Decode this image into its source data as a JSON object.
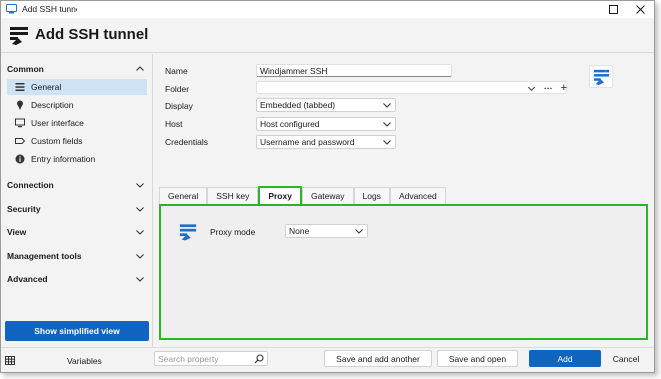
{
  "window": {
    "title": "Add SSH tunnel",
    "header_title": "Add SSH tunnel"
  },
  "sidebar": {
    "sections": [
      {
        "label": "Common",
        "expanded": true
      },
      {
        "label": "Connection",
        "expanded": false
      },
      {
        "label": "Security",
        "expanded": false
      },
      {
        "label": "View",
        "expanded": false
      },
      {
        "label": "Management tools",
        "expanded": false
      },
      {
        "label": "Advanced",
        "expanded": false
      }
    ],
    "common_items": [
      {
        "label": "General",
        "icon": "list-icon",
        "active": true
      },
      {
        "label": "Description",
        "icon": "pin-icon"
      },
      {
        "label": "User interface",
        "icon": "monitor-icon"
      },
      {
        "label": "Custom fields",
        "icon": "tag-icon"
      },
      {
        "label": "Entry information",
        "icon": "info-icon"
      }
    ],
    "simplified_button": "Show simplified view"
  },
  "form": {
    "name_label": "Name",
    "name_value": "Windjammer SSH",
    "folder_label": "Folder",
    "folder_value": "",
    "folder_more": "···",
    "folder_add": "+",
    "display_label": "Display",
    "display_value": "Embedded (tabbed)",
    "host_label": "Host",
    "host_value": "Host configured",
    "credentials_label": "Credentials",
    "credentials_value": "Username and password"
  },
  "tabs": [
    {
      "label": "General"
    },
    {
      "label": "SSH key"
    },
    {
      "label": "Proxy",
      "active": true
    },
    {
      "label": "Gateway"
    },
    {
      "label": "Logs"
    },
    {
      "label": "Advanced"
    }
  ],
  "proxy": {
    "mode_label": "Proxy mode",
    "mode_value": "None"
  },
  "footer": {
    "variables": "Variables",
    "search_placeholder": "Search property",
    "save_add_another": "Save and add another",
    "save_open": "Save and open",
    "add": "Add",
    "cancel": "Cancel"
  },
  "colors": {
    "accent": "#0f65c0",
    "highlight": "#2bb52b",
    "active_item": "#cfe3f5"
  }
}
